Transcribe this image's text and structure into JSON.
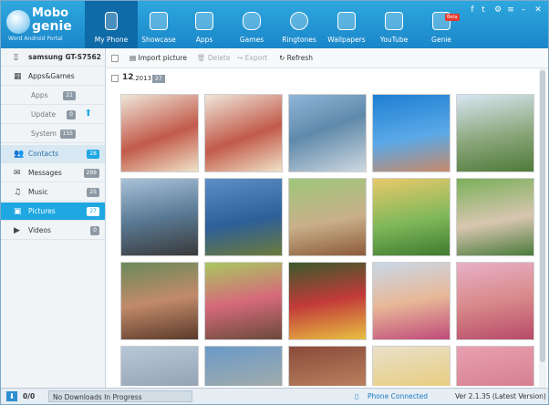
{
  "app": {
    "logo_line1": "Mobo",
    "logo_line2": "genie",
    "logo_tagline": "Word Android Portal"
  },
  "nav": [
    {
      "label": "My Phone",
      "icon": "phone-icon"
    },
    {
      "label": "Showcase",
      "icon": "cube-icon"
    },
    {
      "label": "Apps",
      "icon": "apps-grid-icon"
    },
    {
      "label": "Games",
      "icon": "gamepad-icon"
    },
    {
      "label": "Ringtones",
      "icon": "music-note-icon"
    },
    {
      "label": "Wallpapers",
      "icon": "wallpaper-icon"
    },
    {
      "label": "YouTube",
      "icon": "youtube-icon"
    },
    {
      "label": "Genie",
      "icon": "genie-bag-icon"
    }
  ],
  "beta": "Beta",
  "sidebar": {
    "device": "samsung GT-S7562",
    "apps_games": "Apps&Games",
    "apps": {
      "label": "Apps",
      "count": "21"
    },
    "update": {
      "label": "Update",
      "count": "0"
    },
    "system": {
      "label": "System",
      "count": "155"
    },
    "contacts": {
      "label": "Contacts",
      "count": "28"
    },
    "messages": {
      "label": "Messages",
      "count": "299"
    },
    "music": {
      "label": "Music",
      "count": "25"
    },
    "pictures": {
      "label": "Pictures",
      "count": "27"
    },
    "videos": {
      "label": "Videos",
      "count": "0"
    }
  },
  "toolbar": {
    "import": "Import picture",
    "delete": "Delete",
    "export": "Export",
    "refresh": "Refresh"
  },
  "group": {
    "day": "12",
    "month_year": ".2013",
    "count": "27"
  },
  "status": {
    "downloads": "0/0",
    "progress": "No Downloads In Progress",
    "phone": "Phone Connected",
    "version": "Ver  2.1.35  (Latest Version)"
  },
  "colors": {
    "header": "#1a86c9",
    "accent": "#1ea7e1"
  }
}
